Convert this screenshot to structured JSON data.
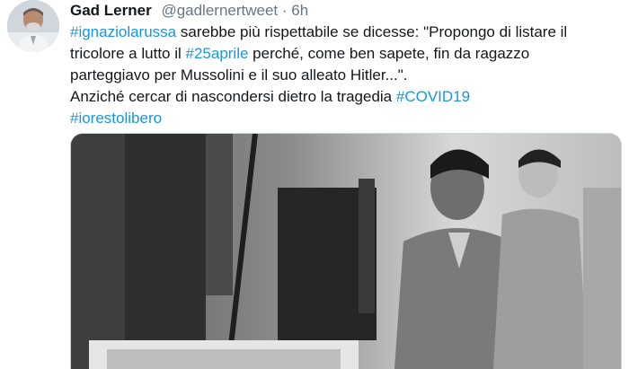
{
  "tweet": {
    "author_name": "Gad Lerner",
    "author_handle": "@gadlernertweet",
    "separator": "·",
    "time": "6h",
    "lines": [
      [
        {
          "text": "#ignaziolarussa",
          "tag": true
        },
        {
          "text": " sarebbe più rispettabile se dicesse: \"Propongo di listare il",
          "tag": false
        }
      ],
      [
        {
          "text": "tricolore a lutto il ",
          "tag": false
        },
        {
          "text": "#25aprile",
          "tag": true
        },
        {
          "text": " perché, come ben sapete, fin da ragazzo",
          "tag": false
        }
      ],
      [
        {
          "text": "parteggiavo per Mussolini e il suo alleato Hitler...\".",
          "tag": false
        }
      ],
      [
        {
          "text": "Anziché cercar di nascondersi dietro la tragedia ",
          "tag": false
        },
        {
          "text": "#COVID19",
          "tag": true
        }
      ],
      [
        {
          "text": "#iorestolibero",
          "tag": true
        }
      ]
    ]
  },
  "colors": {
    "link": "#1b95e0",
    "text": "#14171a",
    "secondary": "#657786",
    "border": "#ccd6dd"
  },
  "icons": {
    "avatar": "author-avatar-photo",
    "media": "black-and-white-news-photo"
  }
}
